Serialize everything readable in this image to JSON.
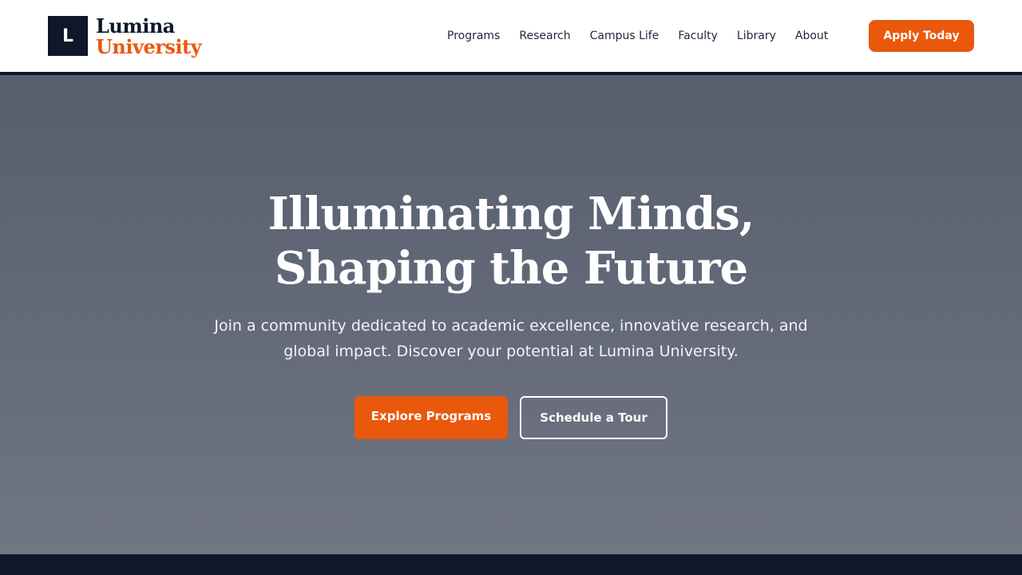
{
  "header": {
    "logo_mark": "L",
    "logo_line1": "Lumina",
    "logo_line2": "University",
    "nav": [
      {
        "label": "Programs"
      },
      {
        "label": "Research"
      },
      {
        "label": "Campus Life"
      },
      {
        "label": "Faculty"
      },
      {
        "label": "Library"
      },
      {
        "label": "About"
      }
    ],
    "apply_label": "Apply Today"
  },
  "hero": {
    "title_line1": "Illuminating Minds,",
    "title_line2": "Shaping the Future",
    "subtitle_line1": "Join a community dedicated to academic excellence, innovative research, and",
    "subtitle_line2": "global impact. Discover your potential at Lumina University.",
    "primary_button": "Explore Programs",
    "secondary_button": "Schedule a Tour"
  },
  "colors": {
    "brand_navy": "#0f172a",
    "accent_orange": "#ea580c"
  }
}
